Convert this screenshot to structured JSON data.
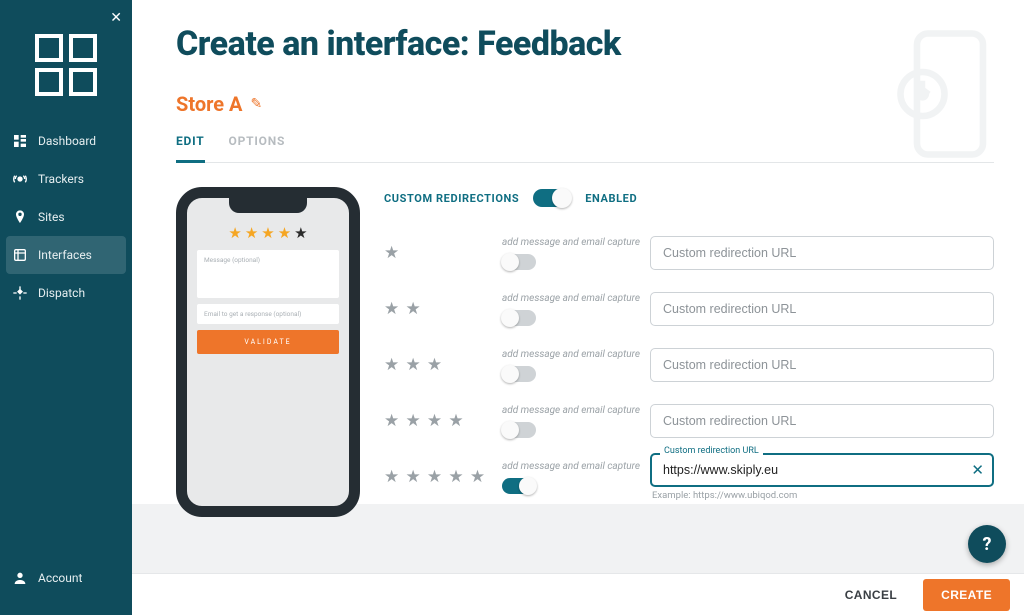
{
  "sidebar": {
    "items": [
      {
        "label": "Dashboard"
      },
      {
        "label": "Trackers"
      },
      {
        "label": "Sites"
      },
      {
        "label": "Interfaces"
      },
      {
        "label": "Dispatch"
      }
    ],
    "account_label": "Account"
  },
  "page": {
    "title": "Create an interface: Feedback",
    "store_name": "Store A"
  },
  "tabs": {
    "edit": "EDIT",
    "options": "OPTIONS"
  },
  "preview": {
    "stars_filled": 4,
    "message_placeholder": "Message (optional)",
    "email_placeholder": "Email to get a response (optional)",
    "validate_label": "VALIDATE"
  },
  "config": {
    "section_label": "CUSTOM REDIRECTIONS",
    "enabled_label": "ENABLED",
    "toggle_hint": "add message and email capture",
    "url_placeholder": "Custom redirection URL",
    "url_floating_label": "Custom redirection URL",
    "example_text": "Example: https://www.ubiqod.com",
    "rows": [
      {
        "stars": 1,
        "capture_on": false,
        "url": ""
      },
      {
        "stars": 2,
        "capture_on": false,
        "url": ""
      },
      {
        "stars": 3,
        "capture_on": false,
        "url": ""
      },
      {
        "stars": 4,
        "capture_on": false,
        "url": ""
      },
      {
        "stars": 5,
        "capture_on": true,
        "url": "https://www.skiply.eu"
      }
    ]
  },
  "footer": {
    "cancel": "CANCEL",
    "create": "CREATE"
  },
  "colors": {
    "brand_teal": "#0f4c5c",
    "accent_teal": "#0f6e82",
    "accent_orange": "#ee752a",
    "star_gold": "#f5a623"
  }
}
